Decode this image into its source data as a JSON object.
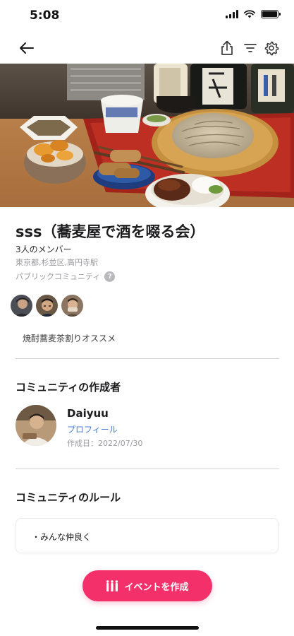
{
  "status_bar": {
    "time": "5:08"
  },
  "community": {
    "title": "sss（蕎麦屋で酒を啜る会）",
    "member_count": "3人のメンバー",
    "location": "東京都,杉並区,高円寺駅",
    "type": "パブリックコミュニティ",
    "help_glyph": "?",
    "tagline": "焼酎蕎麦茶割りオススメ"
  },
  "creator_section": {
    "title": "コミュニティの作成者",
    "name": "Daiyuu",
    "profile_link": "プロフィール",
    "created_date": "作成日：2022/07/30"
  },
  "rules_section": {
    "title": "コミュニティのルール",
    "rules": [
      "・みんな仲良く"
    ]
  },
  "actions": {
    "create_event_label": "イベントを作成"
  },
  "colors": {
    "accent": "#f3306a",
    "link": "#4a7bd0",
    "muted": "#9a9a9f"
  },
  "icons": [
    "back-arrow-icon",
    "share-icon",
    "filter-icon",
    "gear-icon",
    "help-icon",
    "event-icon"
  ]
}
